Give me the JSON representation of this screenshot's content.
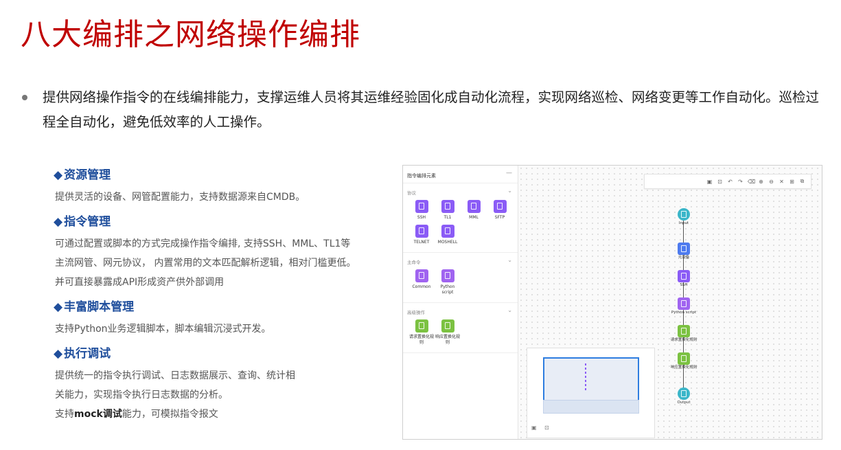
{
  "title": "八大编排之网络操作编排",
  "bullet": "提供网络操作指令的在线编排能力，支撑运维人员将其运维经验固化成自动化流程，实现网络巡检、网络变更等工作自动化。巡检过程全自动化，避免低效率的人工操作。",
  "features": [
    {
      "heading": "资源管理",
      "lines": [
        "提供灵活的设备、网管配置能力，支持数据源来自CMDB。"
      ]
    },
    {
      "heading": "指令管理",
      "lines": [
        "可通过配置或脚本的方式完成操作指令编排, 支持SSH、MML、TL1等",
        "主流网管、网元协议， 内置常用的文本匹配解析逻辑，相对门槛更低。",
        "并可直接暴露成API形成资产供外部调用"
      ]
    },
    {
      "heading": "丰富脚本管理",
      "lines": [
        "支持Python业务逻辑脚本，脚本编辑沉浸式开发。"
      ]
    },
    {
      "heading": "执行调试",
      "lines": [
        "提供统一的指令执行调试、日志数据展示、查询、统计相",
        "关能力，实现指令执行日志数据的分析。"
      ],
      "last_prefix": "支持",
      "last_bold": "mock调试",
      "last_suffix": "能力，可模拟指令报文"
    }
  ],
  "diamond": "◆",
  "editor": {
    "palette_title": "指令编排元素",
    "minimize": "—",
    "chevron": "⌄",
    "sections": [
      {
        "title": "协议",
        "items": [
          {
            "label": "SSH",
            "color": "#8b5cf6"
          },
          {
            "label": "TL1",
            "color": "#8b5cf6"
          },
          {
            "label": "MML",
            "color": "#8b5cf6"
          },
          {
            "label": "SFTP",
            "color": "#8b5cf6"
          },
          {
            "label": "TELNET",
            "color": "#8b5cf6"
          },
          {
            "label": "MOSHELL",
            "color": "#8b5cf6"
          }
        ]
      },
      {
        "title": "主命令",
        "items": [
          {
            "label": "Common",
            "color": "#a064f0"
          },
          {
            "label": "Python script",
            "color": "#a064f0"
          }
        ]
      },
      {
        "title": "高级操作",
        "items": [
          {
            "label": "请求置换化规则",
            "color": "#7cc242"
          },
          {
            "label": "响应置换化规则",
            "color": "#7cc242"
          }
        ]
      }
    ],
    "toolbar": [
      "save-icon",
      "export-icon",
      "undo-icon",
      "redo-icon",
      "delete-icon",
      "zoom-in-icon",
      "zoom-out-icon",
      "close-icon",
      "fit-icon",
      "copy-icon"
    ],
    "toolbar_glyphs": [
      "▣",
      "⊡",
      "↶",
      "↷",
      "⌫",
      "⊕",
      "⊖",
      "✕",
      "⊞",
      "⧉"
    ],
    "flow": [
      {
        "label": "Input",
        "shape": "circle",
        "color": "#3bb6c9"
      },
      {
        "label": "元设备",
        "shape": "square",
        "color": "#4e7bef"
      },
      {
        "label": "SSH",
        "shape": "square",
        "color": "#8b5cf6"
      },
      {
        "label": "Python script",
        "shape": "square",
        "color": "#a064f0"
      },
      {
        "label": "请求置换化规则",
        "shape": "square",
        "color": "#7cc242"
      },
      {
        "label": "响应置换化规则",
        "shape": "square",
        "color": "#7cc242"
      },
      {
        "label": "Output",
        "shape": "circle",
        "color": "#3bb6c9"
      }
    ],
    "minimap_buttons": [
      "▣",
      "⊡"
    ]
  }
}
